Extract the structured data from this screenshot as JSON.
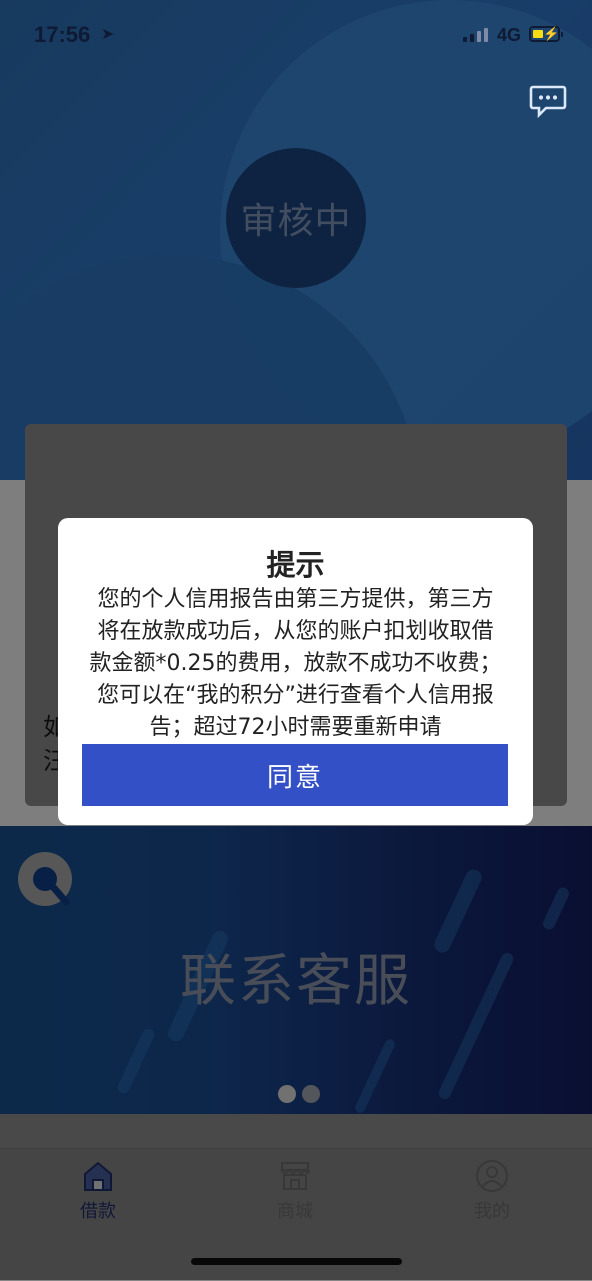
{
  "status_bar": {
    "time": "17:56",
    "network": "4G"
  },
  "hero": {
    "status_text": "审核中"
  },
  "banner": {
    "title": "联系客服",
    "page_index": 1,
    "page_count": 2
  },
  "tabs": [
    {
      "label": "借款",
      "icon": "home-icon",
      "active": true
    },
    {
      "label": "商城",
      "icon": "store-icon",
      "active": false
    },
    {
      "label": "我的",
      "icon": "profile-icon",
      "active": false
    }
  ],
  "background_card": {
    "visible_text_lines": [
      "如",
      "汪"
    ]
  },
  "dialog": {
    "title": "提示",
    "message_lines": [
      "您的个人信用报告由第三方提供，第三方",
      "将在放款成功后，从您的账户扣划收取借",
      "款金额*0.25的费用，放款不成功不收费；",
      "您可以在“我的积分”进行查看个人信用报",
      "告；超过72小时需要重新申请"
    ],
    "button_label": "同意"
  },
  "colors": {
    "primary_button": "#3450c7",
    "hero_blue": "#2f78c9",
    "tab_active": "#1f2f6b"
  }
}
